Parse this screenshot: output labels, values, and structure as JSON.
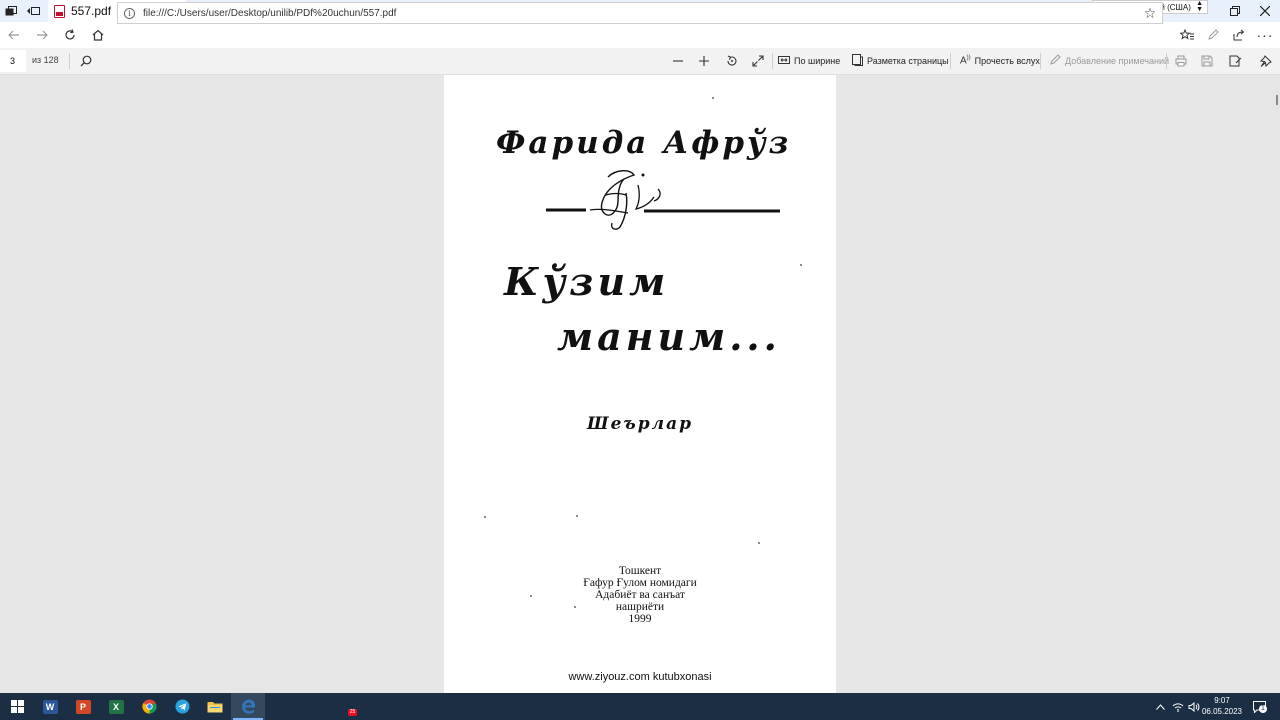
{
  "window": {
    "tab_title": "557.pdf",
    "tab_close": "✕",
    "new_tab": "+",
    "tab_menu": "⌵",
    "language": "EN Английский (США)"
  },
  "address_bar": {
    "url": "file:///C:/Users/user/Desktop/unilib/PDf%20uchun/557.pdf",
    "info_icon": "i"
  },
  "pdf_toolbar": {
    "page_number": "3",
    "page_count": "из 128",
    "fit_width_label": "По ширине",
    "page_layout_label": "Разметка страницы",
    "read_aloud_label": "Прочесть вслух",
    "add_notes_label": "Добавление примечаний"
  },
  "document": {
    "author": "Фарида Афрўз",
    "title_line1": "Кўзим",
    "title_line2": "маним...",
    "genre": "Шеърлар",
    "imprint": [
      "Тошкент",
      "Ғафур Ғулом номидаги",
      "Адабиёт ва санъат",
      "нашриёти",
      "1999"
    ],
    "footer": "www.ziyouz.com kutubxonasi"
  },
  "taskbar": {
    "apps": [
      {
        "name": "word",
        "letter": "W",
        "color": "#2b579a"
      },
      {
        "name": "powerpoint",
        "letter": "P",
        "color": "#d24726"
      },
      {
        "name": "excel",
        "letter": "X",
        "color": "#217346"
      },
      {
        "name": "chrome",
        "letter": "",
        "color": "#ffffff"
      },
      {
        "name": "telegram",
        "letter": "",
        "color": "#2aa3df"
      },
      {
        "name": "file-explorer",
        "letter": "",
        "color": "#f3c140"
      },
      {
        "name": "edge",
        "letter": "e",
        "color": "#3277bc"
      }
    ],
    "telegram_badge": "25",
    "time": "9:07",
    "date": "06.05.2023",
    "notification_count": "1"
  },
  "colors": {
    "tab_strip": "#e8f0fb",
    "taskbar": "#1b2e44",
    "viewer_bg": "#e6e6e6",
    "pdf_red": "#c8102e"
  }
}
